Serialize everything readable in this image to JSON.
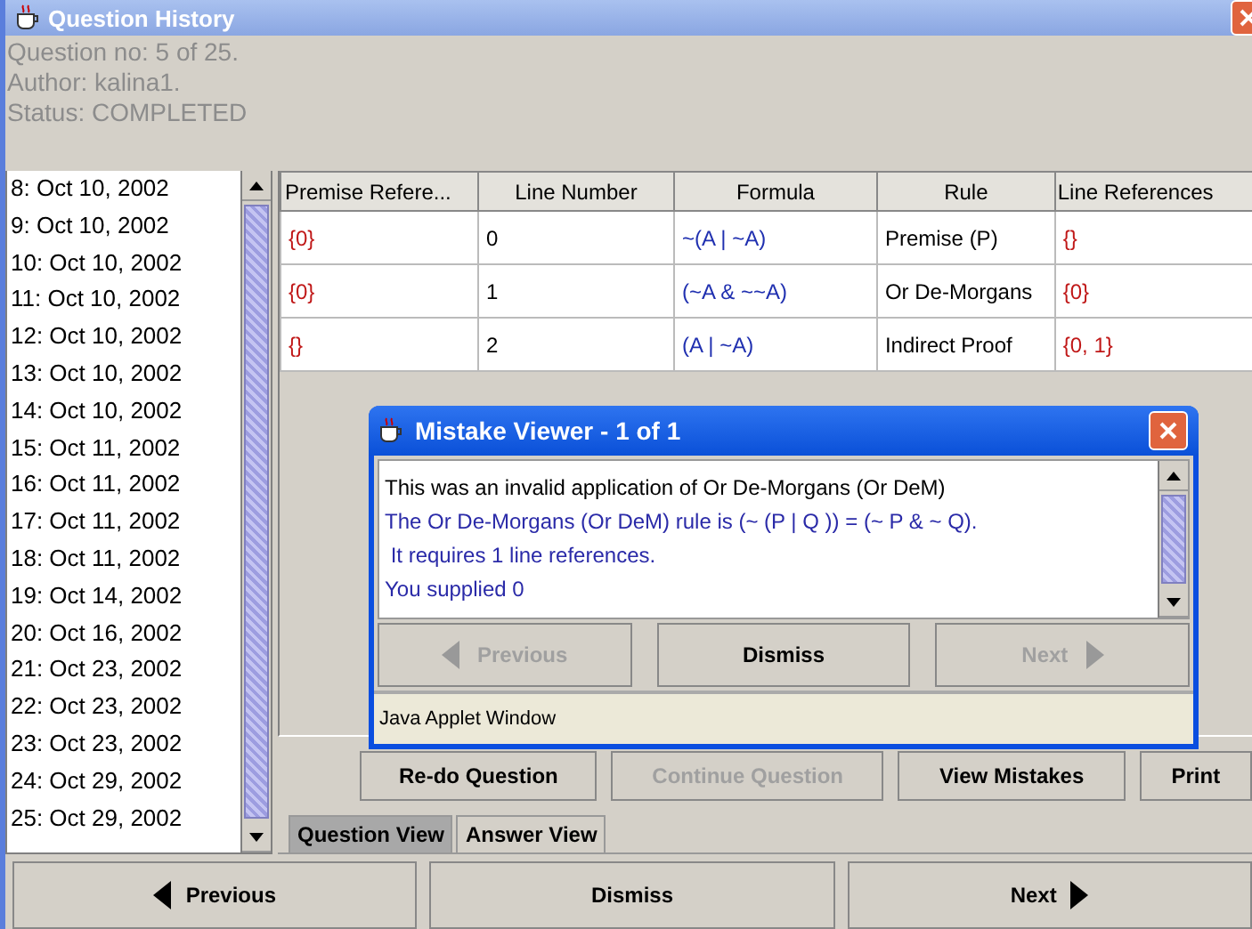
{
  "window": {
    "title": "Question History"
  },
  "info": [
    "Question no: 5 of 25.",
    "Author: kalina1.",
    "Status: COMPLETED"
  ],
  "history": [
    "8: Oct 10, 2002",
    "9: Oct 10, 2002",
    "10: Oct 10, 2002",
    "11: Oct 10, 2002",
    "12: Oct 10, 2002",
    "13: Oct 10, 2002",
    "14: Oct 10, 2002",
    "15: Oct 11, 2002",
    "16: Oct 11, 2002",
    "17: Oct 11, 2002",
    "18: Oct 11, 2002",
    "19: Oct 14, 2002",
    "20: Oct 16, 2002",
    "21: Oct 23, 2002",
    "22: Oct 23, 2002",
    "23: Oct 23, 2002",
    "24: Oct 29, 2002",
    "25: Oct 29, 2002"
  ],
  "table": {
    "columns": [
      "Premise Refere...",
      "Line Number",
      "Formula",
      "Rule",
      "Line References"
    ],
    "rows": [
      {
        "premise": "{0}",
        "line": "0",
        "formula": "~(A | ~A)",
        "rule": "Premise (P)",
        "refs": "{}"
      },
      {
        "premise": "{0}",
        "line": "1",
        "formula": "(~A & ~~A)",
        "rule": "Or De-Morgans",
        "refs": "{0}"
      },
      {
        "premise": "{}",
        "line": "2",
        "formula": "(A | ~A)",
        "rule": "Indirect Proof",
        "refs": "{0, 1}"
      }
    ]
  },
  "dialog": {
    "title": "Mistake Viewer - 1 of 1",
    "lines": [
      {
        "text": "This was an invalid application of Or De-Morgans (Or DeM)",
        "kind": "plain"
      },
      {
        "text": "The Or De-Morgans (Or DeM) rule is (~ (P | Q )) = (~ P & ~ Q).",
        "kind": "hint"
      },
      {
        "text": " It requires 1 line references.",
        "kind": "hint"
      },
      {
        "text": "You supplied 0",
        "kind": "hint"
      }
    ],
    "buttons": [
      {
        "label": "Previous",
        "kind": "prev",
        "disabled": true
      },
      {
        "label": "Dismiss",
        "kind": "plain",
        "disabled": false
      },
      {
        "label": "Next",
        "kind": "next",
        "disabled": true
      }
    ],
    "status": "Java Applet Window"
  },
  "actions": [
    {
      "label": "Re-do Question",
      "disabled": false
    },
    {
      "label": "Continue Question",
      "disabled": true
    },
    {
      "label": "View Mistakes",
      "disabled": false
    },
    {
      "label": "Print",
      "disabled": false
    }
  ],
  "tabs": [
    {
      "label": "Question View",
      "selected": true
    },
    {
      "label": "Answer View",
      "selected": false
    }
  ],
  "nav": [
    {
      "label": "Previous",
      "kind": "prev"
    },
    {
      "label": "Dismiss",
      "kind": "plain"
    },
    {
      "label": "Next",
      "kind": "next"
    }
  ]
}
